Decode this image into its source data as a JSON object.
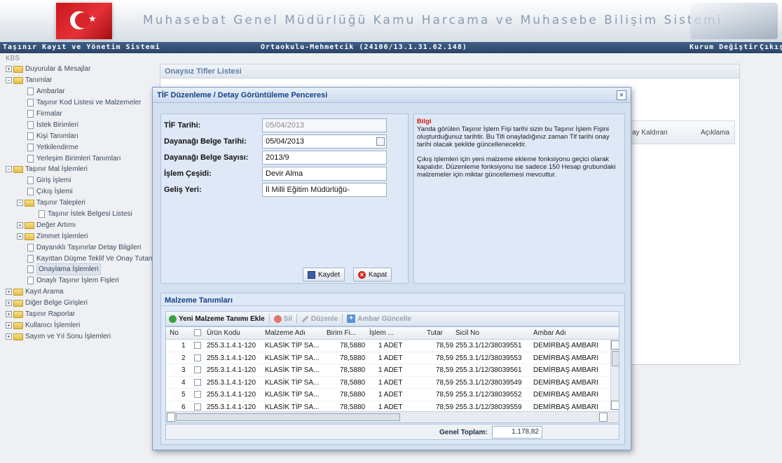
{
  "header": {
    "title": "Muhasebat Genel Müdürlüğü Kamu Harcama ve Muhasebe Bilişim Sistemi",
    "system": "Taşınır Kayıt ve Yönetim Sistemi",
    "institution": "Ortaokulu-Mehmetcik (24100/13.1.31.62.148)",
    "change_institution": "Kurum Değiştir",
    "logout": "Çıkış"
  },
  "tree": {
    "root": "KBS",
    "items": [
      {
        "label": "Duyurular & Mesajlar"
      },
      {
        "label": "Tanımlar"
      },
      {
        "label": "Ambarlar"
      },
      {
        "label": "Taşınır Kod Listesi ve Malzemeler"
      },
      {
        "label": "Firmalar"
      },
      {
        "label": "İstek Birimleri"
      },
      {
        "label": "Kişi Tanımları"
      },
      {
        "label": "Yetkilendirme"
      },
      {
        "label": "Yerleşim Birimleri Tanımları"
      },
      {
        "label": "Taşınır Mal İşlemleri"
      },
      {
        "label": "Giriş İşlemi"
      },
      {
        "label": "Çıkış İşlemi"
      },
      {
        "label": "Taşınır Talepleri"
      },
      {
        "label": "Taşınır İstek Belgesi Listesi"
      },
      {
        "label": "Değer Artımı"
      },
      {
        "label": "Zimmet İşlemleri"
      },
      {
        "label": "Dayanıklı Taşınırlar Detay Bilgileri"
      },
      {
        "label": "Kayıttan Düşme Teklif Ve Onay Tutanağı"
      },
      {
        "label": "Onaylama İşlemleri"
      },
      {
        "label": "Onaylı Taşınır İşlem Fişleri"
      },
      {
        "label": "Kayıt Arama"
      },
      {
        "label": "Diğer Belge Girişleri"
      },
      {
        "label": "Taşınır Raporlar"
      },
      {
        "label": "Kullanıcı İşlemleri"
      },
      {
        "label": "Sayım ve Yıl Sonu İşlemleri"
      }
    ]
  },
  "main": {
    "panel_title": "Onaysız Tifler Listesi",
    "col_1": "ay Kaldıran",
    "col_2": "Açıklama"
  },
  "modal": {
    "title": "TİF Düzenleme / Detay Görüntüleme Penceresi",
    "fields": {
      "tif_tarihi_label": "TİF Tarihi:",
      "tif_tarihi": "05/04/2013",
      "belge_tarihi_label": "Dayanağı Belge Tarihi:",
      "belge_tarihi": "05/04/2013",
      "belge_sayisi_label": "Dayanağı Belge Sayısı:",
      "belge_sayisi": "2013/9",
      "islem_cesidi_label": "İşlem Çeşidi:",
      "islem_cesidi": "Devir Alma",
      "gelis_yeri_label": "Geliş Yeri:",
      "gelis_yeri": "İl Milli Eğitim Müdürlüğü-"
    },
    "buttons": {
      "save": "Kaydet",
      "close": "Kapat"
    },
    "info": {
      "title": "Bilgi",
      "p1": "Yanda görülen Taşınır İşlem Fişi tarihi sizin bu Taşınır İşlem Fişini oluşturduğunuz tarihtir. Bu Tifi onayladığınız zaman Tif tarihi onay tarihi olacak şekilde güncellenecektir.",
      "p2": "Çıkış işlemleri için yeni malzeme ekleme fonksiyonu geçici olarak kapalıdır. Düzenleme fonksiyonu ise sadece 150 Hesap grubundaki malzemeler için miktar güncellemesi mevcuttur."
    },
    "materials": {
      "section_title": "Malzeme Tanımları",
      "toolbar": {
        "add": "Yeni Malzeme Tanımı Ekle",
        "delete": "Sil",
        "edit": "Düzenle",
        "update_store": "Ambar Güncelle"
      },
      "columns": [
        "No",
        "Ürün Kodu",
        "Malzeme Adı",
        "Birim Fi...",
        "İşlem ...",
        "Tutar",
        "Sicil No",
        "Ambar Adı"
      ],
      "rows": [
        {
          "no": "1",
          "code": "255.3.1.4.1-120",
          "name": "KLASİK TİP SA...",
          "price": "78,5880",
          "qty": "1  ADET",
          "total": "78,59",
          "sicil": "255.3.1/12/38039551",
          "store": "DEMİRBAŞ AMBARI"
        },
        {
          "no": "2",
          "code": "255.3.1.4.1-120",
          "name": "KLASİK TİP SA...",
          "price": "78,5880",
          "qty": "1  ADET",
          "total": "78,59",
          "sicil": "255.3.1/12/38039553",
          "store": "DEMİRBAŞ AMBARI"
        },
        {
          "no": "3",
          "code": "255.3.1.4.1-120",
          "name": "KLASİK TİP SA...",
          "price": "78,5880",
          "qty": "1  ADET",
          "total": "78,59",
          "sicil": "255.3.1/12/38039561",
          "store": "DEMİRBAŞ AMBARI"
        },
        {
          "no": "4",
          "code": "255.3.1.4.1-120",
          "name": "KLASİK TİP SA...",
          "price": "78,5880",
          "qty": "1  ADET",
          "total": "78,59",
          "sicil": "255.3.1/12/38039549",
          "store": "DEMİRBAŞ AMBARI"
        },
        {
          "no": "5",
          "code": "255.3.1.4.1-120",
          "name": "KLASİK TİP SA...",
          "price": "78,5880",
          "qty": "1  ADET",
          "total": "78,59",
          "sicil": "255.3.1/12/38039552",
          "store": "DEMİRBAŞ AMBARI"
        },
        {
          "no": "6",
          "code": "255.3.1.4.1-120",
          "name": "KLASİK TİP SA...",
          "price": "78,5880",
          "qty": "1  ADET",
          "total": "78,59",
          "sicil": "255.3.1/12/38039559",
          "store": "DEMİRBAŞ AMBARI"
        }
      ],
      "total_label": "Genel Toplam:",
      "total_value": "1.178,82"
    }
  }
}
